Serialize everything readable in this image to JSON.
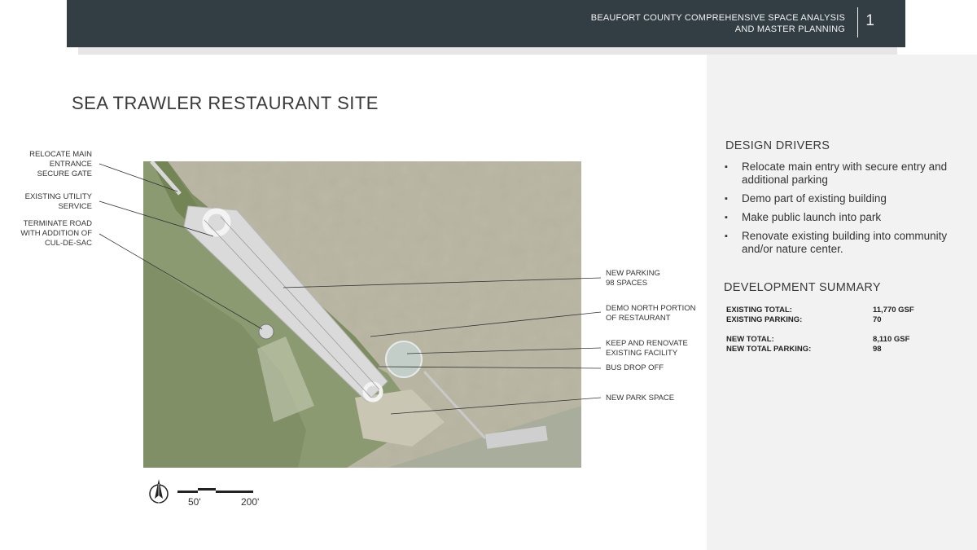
{
  "header": {
    "title_line1": "BEAUFORT COUNTY COMPREHENSIVE SPACE ANALYSIS",
    "title_line2": "AND MASTER PLANNING",
    "page_number": "1"
  },
  "page_title": "SEA TRAWLER RESTAURANT SITE",
  "callouts_left": [
    {
      "lines": [
        "RELOCATE MAIN",
        "ENTRANCE",
        "SECURE GATE"
      ]
    },
    {
      "lines": [
        "EXISTING UTILITY",
        "SERVICE"
      ]
    },
    {
      "lines": [
        "TERMINATE ROAD",
        "WITH ADDITION OF",
        "CUL-DE-SAC"
      ]
    }
  ],
  "callouts_right": [
    {
      "lines": [
        "NEW PARKING",
        "98 SPACES"
      ]
    },
    {
      "lines": [
        "DEMO NORTH PORTION",
        "OF RESTAURANT"
      ]
    },
    {
      "lines": [
        "KEEP AND RENOVATE",
        "EXISTING FACILITY"
      ]
    },
    {
      "lines": [
        "BUS DROP OFF"
      ]
    },
    {
      "lines": [
        "NEW PARK SPACE"
      ]
    }
  ],
  "design_drivers": {
    "heading": "DESIGN DRIVERS",
    "bullet": "▪",
    "items": [
      "Relocate main entry with secure entry and additional parking",
      "Demo part of existing building",
      "Make public launch into park",
      "Renovate existing building into community and/or nature center."
    ]
  },
  "development_summary": {
    "heading": "DEVELOPMENT SUMMARY",
    "rows": [
      {
        "label": "EXISTING TOTAL:",
        "value": "11,770 GSF"
      },
      {
        "label": "EXISTING PARKING:",
        "value": "70"
      },
      {
        "label": "NEW TOTAL:",
        "value": "8,110 GSF"
      },
      {
        "label": "NEW TOTAL PARKING:",
        "value": "98"
      }
    ]
  },
  "scale": {
    "label_a": "50'",
    "label_b": "200'"
  },
  "colors": {
    "header_bg": "#323e44",
    "panel_bg": "#f2f2f2",
    "marsh": "#b5b39e",
    "water": "#a9ad9b",
    "land": "#8c9a72",
    "trees": "#6b7d4c",
    "paving": "#dadada"
  }
}
